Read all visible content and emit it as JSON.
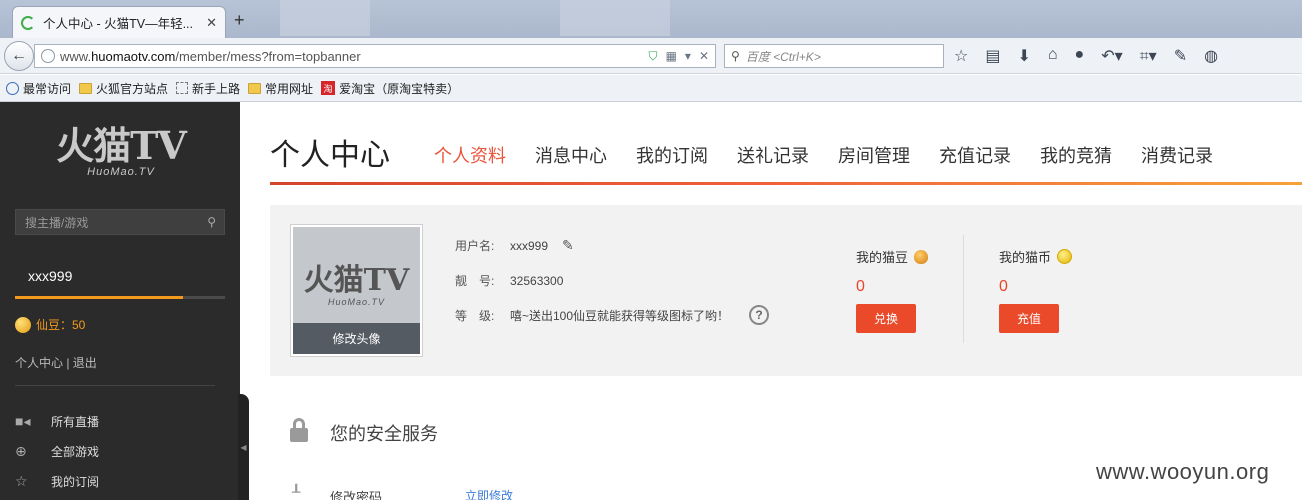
{
  "browser": {
    "tab_title": "个人中心 - 火猫TV—年轻...",
    "tab_close": "✕",
    "new_tab": "+",
    "url_prefix": "www.",
    "url_domain": "huomaotv.com",
    "url_path": "/member/mess?from=topbanner",
    "search_placeholder": "百度 <Ctrl+K>",
    "bookmarks": [
      "最常访问",
      "火狐官方站点",
      "新手上路",
      "常用网址",
      "爱淘宝（原淘宝特卖）"
    ],
    "tao_icon": "淘"
  },
  "sidebar": {
    "logo_main": "火猫TV",
    "logo_sub": "HuoMao.TV",
    "search_placeholder": "搜主播/游戏",
    "username": "xxx999",
    "level_progress": 0.8,
    "beans_label": "仙豆：50",
    "user_links": "个人中心 | 退出",
    "menu": [
      {
        "icon": "video-camera-icon",
        "label": "所有直播"
      },
      {
        "icon": "gamepad-icon",
        "label": "全部游戏"
      },
      {
        "icon": "star-icon",
        "label": "我的订阅"
      }
    ],
    "collapse_arrow": "◀"
  },
  "main": {
    "page_title": "个人中心",
    "tabs": [
      "个人资料",
      "消息中心",
      "我的订阅",
      "送礼记录",
      "房间管理",
      "充值记录",
      "我的竞猜",
      "消费记录"
    ],
    "active_tab": 0,
    "profile": {
      "avatar_button": "修改头像",
      "username_label": "用户名:",
      "username_value": "xxx999",
      "id_label": "靓　号:",
      "id_value": "32563300",
      "level_label": "等　级:",
      "level_value": "嘻~送出100仙豆就能获得等级图标了哟！",
      "help": "?"
    },
    "wallet": [
      {
        "title": "我的猫豆",
        "value": "0",
        "button": "兑换",
        "icon": "bean-icon"
      },
      {
        "title": "我的猫币",
        "value": "0",
        "button": "充值",
        "icon": "coin-icon"
      }
    ],
    "security": {
      "title": "您的安全服务",
      "password_label": "修改密码",
      "password_link": "立即修改"
    }
  },
  "watermark": "www.wooyun.org",
  "colors": {
    "accent": "#e9553a",
    "button": "#ea4a2a",
    "sidebar_bg": "#2b2b2b",
    "bean": "#f39a1d"
  }
}
